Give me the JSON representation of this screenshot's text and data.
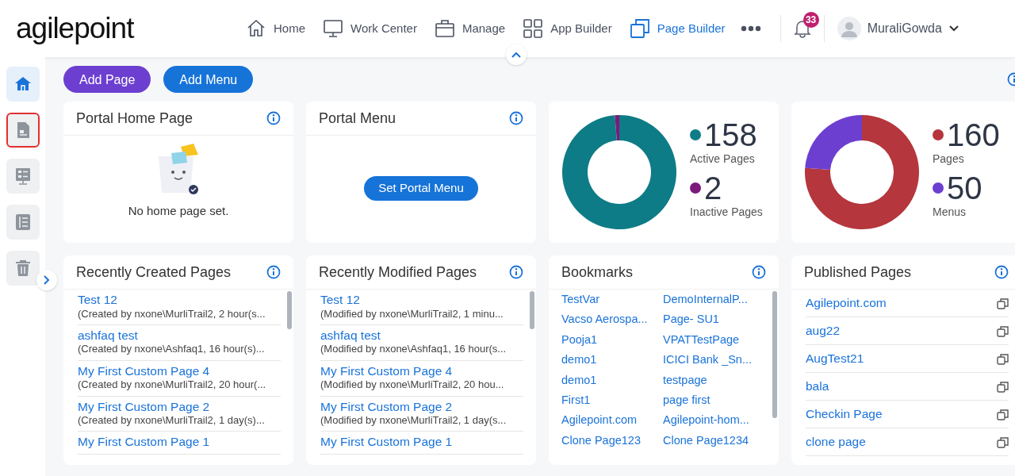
{
  "header": {
    "logo": "agilepoint",
    "nav": [
      {
        "label": "Home",
        "selected": false
      },
      {
        "label": "Work Center",
        "selected": false
      },
      {
        "label": "Manage",
        "selected": false
      },
      {
        "label": "App Builder",
        "selected": false
      },
      {
        "label": "Page Builder",
        "selected": true
      }
    ],
    "notifications": "33",
    "user": "MuraliGowda"
  },
  "sidebar": {
    "items": [
      {
        "selected": true,
        "highlighted": false
      },
      {
        "selected": false,
        "highlighted": true
      },
      {
        "selected": false,
        "highlighted": false
      },
      {
        "selected": false,
        "highlighted": false
      },
      {
        "selected": false,
        "highlighted": false
      }
    ]
  },
  "toolbar": {
    "buttons": [
      {
        "label": "Add Page",
        "kind": "purple"
      },
      {
        "label": "Add Menu",
        "kind": "blue"
      }
    ]
  },
  "portal_home": {
    "title": "Portal Home Page",
    "message": "No home page set."
  },
  "portal_menu": {
    "title": "Portal Menu",
    "button": "Set Portal Menu"
  },
  "charts": [
    {
      "legend": [
        {
          "value": "158",
          "color": "#0e7c86"
        },
        {
          "value": "2",
          "color": "#7b1a7c"
        }
      ],
      "chart_data": {
        "type": "donut",
        "categories": [
          "Active Pages",
          "Inactive Pages"
        ],
        "values": [
          98.75,
          1.25
        ],
        "legend": "right"
      }
    },
    {
      "legend": [
        {
          "value": "160",
          "color": "#b5363d"
        },
        {
          "value": "50",
          "color": "#6c3fd1"
        }
      ],
      "chart_data": {
        "type": "donut",
        "categories": [
          "Pages",
          "Menus"
        ],
        "values": [
          76.19,
          23.81
        ],
        "legend": "right"
      }
    }
  ],
  "recently_created": {
    "title": "Recently Created Pages",
    "items": [
      {
        "name": "Test 12",
        "detail": "(Created by nxone\\MurliTrail2, 2 hour(s..."
      },
      {
        "name": "ashfaq test",
        "detail": "(Created by nxone\\Ashfaq1, 16 hour(s)..."
      },
      {
        "name": "My First Custom Page 4",
        "detail": "(Created by nxone\\MurliTrail2, 20 hour(..."
      },
      {
        "name": "My First Custom Page 2",
        "detail": "(Created by nxone\\MurliTrail2, 1 day(s)..."
      },
      {
        "name": "My First Custom Page 1"
      }
    ]
  },
  "recently_modified": {
    "title": "Recently Modified Pages",
    "items": [
      {
        "name": "Test 12",
        "detail": "(Modified by nxone\\MurliTrail2, 1 minu..."
      },
      {
        "name": "ashfaq test",
        "detail": "(Modified by nxone\\Ashfaq1, 16 hour(s..."
      },
      {
        "name": "My First Custom Page 4",
        "detail": "(Modified by nxone\\MurliTrail2, 20 hou..."
      },
      {
        "name": "My First Custom Page 2",
        "detail": "(Modified by nxone\\MurliTrail2, 1 day(s..."
      },
      {
        "name": "My First Custom Page 1"
      }
    ]
  },
  "bookmarks": {
    "title": "Bookmarks",
    "items": [
      "TestVar",
      "DemoInternalP...",
      "Vacso Aerospa...",
      "Page- SU1",
      "Pooja1",
      "VPATTestPage",
      "demo1",
      "ICICI Bank _Sn...",
      "demo1",
      "testpage",
      "First1",
      "page first",
      "Agilepoint.com",
      "Agilepoint-hom...",
      "Clone Page123",
      "Clone Page1234"
    ]
  },
  "published": {
    "title": "Published Pages",
    "items": [
      "Agilepoint.com",
      "aug22",
      "AugTest21",
      "bala",
      "Checkin Page",
      "clone page"
    ]
  }
}
